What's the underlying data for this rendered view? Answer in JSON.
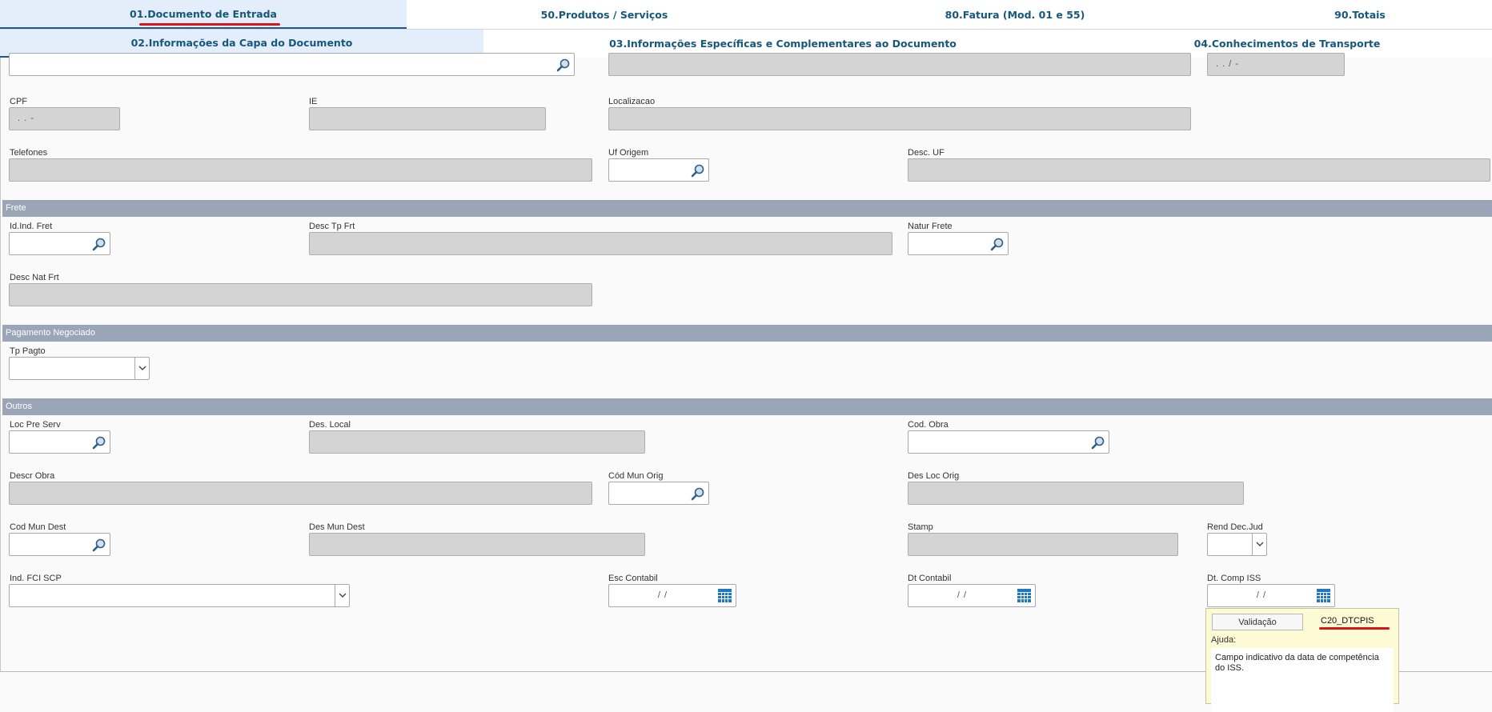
{
  "tabs_main": [
    {
      "label": "01.Documento de Entrada",
      "active": true
    },
    {
      "label": "50.Produtos / Serviços",
      "active": false
    },
    {
      "label": "80.Fatura (Mod. 01 e 55)",
      "active": false
    },
    {
      "label": "90.Totais",
      "active": false
    }
  ],
  "tabs_sub": [
    {
      "label": "02.Informações da Capa do Documento",
      "active": true
    },
    {
      "label": "03.Informações Específicas e Complementares ao Documento",
      "active": false
    },
    {
      "label": "04.Conhecimentos de Transporte",
      "active": false
    }
  ],
  "top_fields": {
    "date_placeholder": ". .  /  -"
  },
  "fields": {
    "cpf": {
      "label": "CPF",
      "placeholder": ". .  -"
    },
    "ie": {
      "label": "IE"
    },
    "localizacao": {
      "label": "Localizacao"
    },
    "telefones": {
      "label": "Telefones"
    },
    "uf_origem": {
      "label": "Uf Origem"
    },
    "desc_uf": {
      "label": "Desc. UF"
    },
    "id_ind_fret": {
      "label": "Id.Ind. Fret"
    },
    "desc_tp_frt": {
      "label": "Desc Tp Frt"
    },
    "natur_frete": {
      "label": "Natur  Frete"
    },
    "desc_nat_frt": {
      "label": "Desc Nat Frt"
    },
    "tp_pagto": {
      "label": "Tp Pagto"
    },
    "loc_pre_serv": {
      "label": "Loc Pre Serv"
    },
    "des_local": {
      "label": "Des. Local"
    },
    "cod_obra": {
      "label": "Cod. Obra"
    },
    "descr_obra": {
      "label": "Descr Obra"
    },
    "cod_mun_orig": {
      "label": "Cód Mun Orig"
    },
    "des_loc_orig": {
      "label": "Des Loc Orig"
    },
    "cod_mun_dest": {
      "label": "Cod Mun Dest"
    },
    "des_mun_dest": {
      "label": "Des Mun Dest"
    },
    "stamp": {
      "label": "Stamp"
    },
    "rend_dec_jud": {
      "label": "Rend Dec.Jud"
    },
    "ind_fci_scp": {
      "label": "Ind. FCI SCP"
    },
    "esc_contabil": {
      "label": "Esc Contabil",
      "placeholder": "/  /"
    },
    "dt_contabil": {
      "label": "Dt Contabil",
      "placeholder": "/  /"
    },
    "dt_comp_iss": {
      "label": "Dt. Comp ISS",
      "placeholder": "/  /"
    }
  },
  "sections": {
    "frete": "Frete",
    "pagamento": "Pagamento Negociado",
    "outros": "Outros"
  },
  "help_popup": {
    "button": "Validação",
    "field_code": "C20_DTCPIS",
    "help_label": "Ajuda:",
    "help_text": "Campo indicativo da data de competência do ISS."
  },
  "colors": {
    "tab_text": "#16577e",
    "tab_active_bg": "#e3eefa",
    "section_bg": "#9aa5b8",
    "readonly_field": "#d4d4d4",
    "highlight_underline": "#d9141c",
    "help_bg": "#fdfbd4"
  }
}
